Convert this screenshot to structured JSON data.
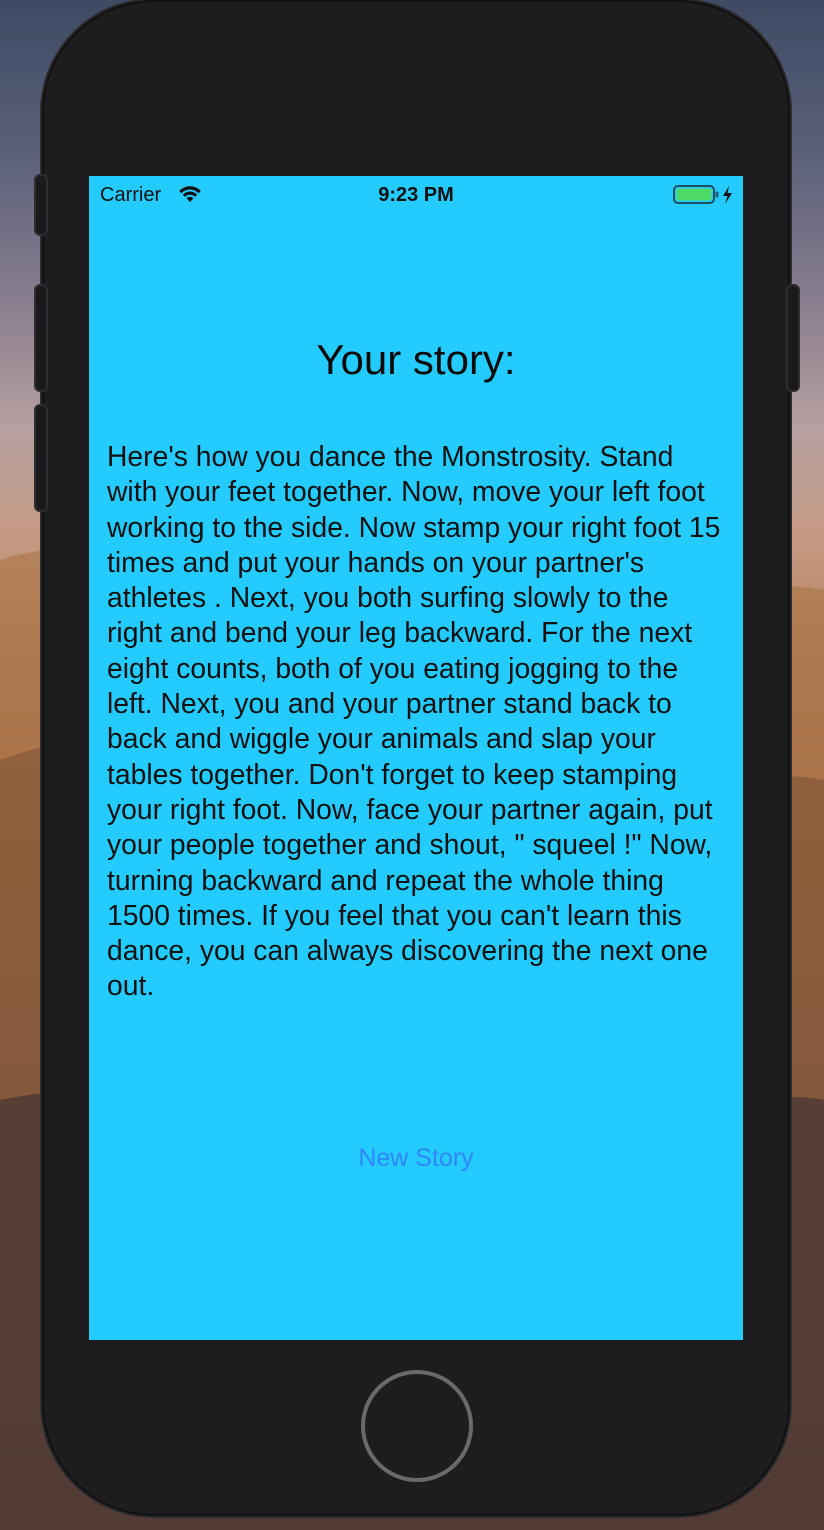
{
  "status_bar": {
    "carrier": "Carrier",
    "time": "9:23 PM",
    "wifi_icon": "wifi-icon",
    "battery_icon": "battery-charging-icon",
    "battery_color": "#4cd964"
  },
  "screen": {
    "background_color": "#23cbff",
    "title": "Your story:",
    "story_text": "Here's how you dance the Monstrosity. Stand with your feet together. Now, move your left foot working to the side. Now stamp your right foot 15 times and put your hands on your partner's athletes . Next, you both surfing slowly to the right and bend your leg backward. For the next eight counts, both of you eating jogging to the left. Next, you and your partner stand back to back and wiggle your animals and slap your tables together. Don't forget to keep stamping your right foot. Now, face your partner again, put your people together and shout, \" squeel !\" Now, turning backward and repeat the whole thing 1500 times. If you feel that you can't learn this dance, you can always discovering the next one out.",
    "new_story_button": "New Story",
    "button_color": "#2f86ff"
  },
  "device": {
    "home_button_icon": "home-button"
  }
}
